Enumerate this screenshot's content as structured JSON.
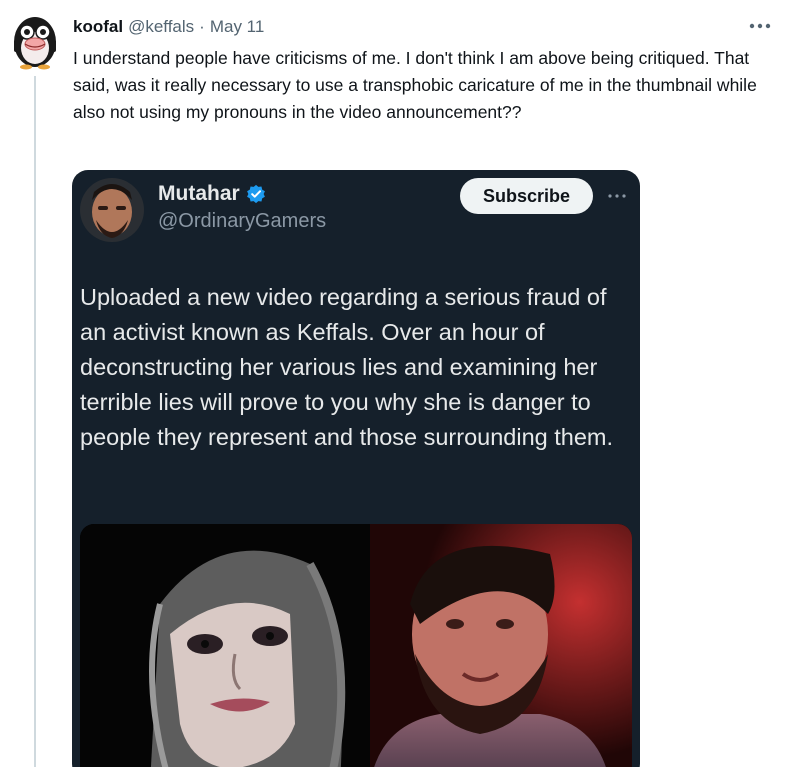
{
  "tweet": {
    "author_name": "koofal",
    "author_handle": "@keffals",
    "separator": "·",
    "date": "May 11",
    "more_icon": "more-horizontal-icon",
    "text": "I understand people have criticisms of me. I don't think I am above being critiqued. That said, was it really necessary to use a transphobic caricature of me in the thumbnail while also not using my pronouns in the video announcement??"
  },
  "embedded": {
    "author_name": "Mutahar",
    "author_handle": "@OrdinaryGamers",
    "verified_icon": "verified-badge-icon",
    "subscribe_label": "Subscribe",
    "more_icon": "more-horizontal-icon",
    "text": "Uploaded a new video regarding a serious fraud of an activist known as Keffals. Over an hour of deconstructing her various lies and examining her terrible lies will prove to you why she is danger to people they represent and those surrounding them."
  },
  "colors": {
    "link_blue": "#1d9bf0",
    "secondary_text": "#536471",
    "embed_bg": "#15202b",
    "embed_text": "#e7e9ea"
  }
}
